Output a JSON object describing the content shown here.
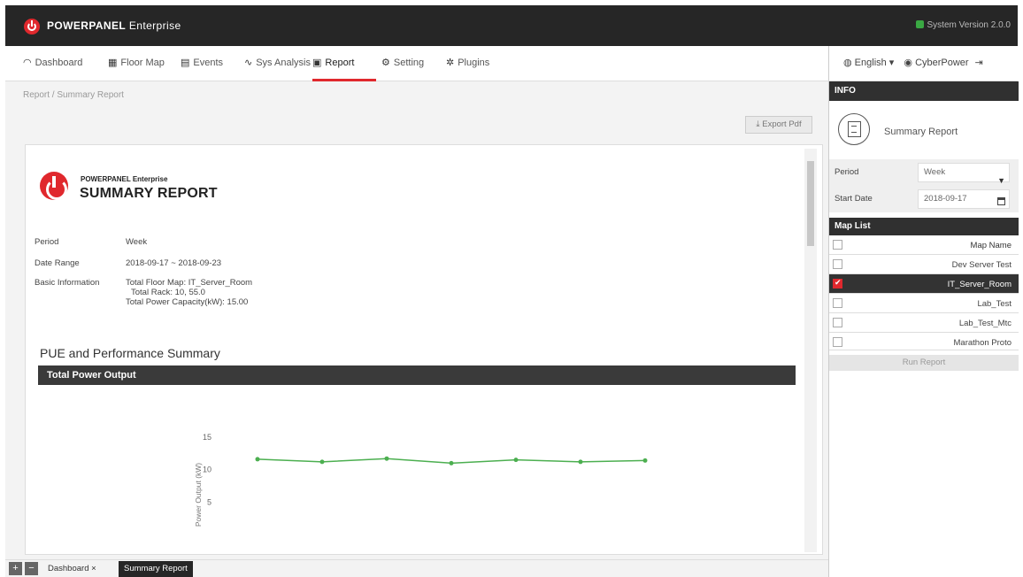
{
  "header": {
    "brand_strong": "POWERPANEL",
    "brand_light": " Enterprise",
    "system_version": "System Version 2.0.0"
  },
  "nav": {
    "items": [
      {
        "label": "Dashboard",
        "icon": "gauge-icon"
      },
      {
        "label": "Floor Map",
        "icon": "map-icon"
      },
      {
        "label": "Events",
        "icon": "events-icon"
      },
      {
        "label": "Sys Analysis",
        "icon": "analysis-icon"
      },
      {
        "label": "Report",
        "icon": "report-icon"
      },
      {
        "label": "Setting",
        "icon": "gear-icon"
      },
      {
        "label": "Plugins",
        "icon": "plugin-icon"
      }
    ],
    "active": "Report",
    "language": "English ▾",
    "user": "CyberPower"
  },
  "breadcrumb": "Report / Summary Report",
  "export_button": "Export Pdf",
  "report": {
    "brand_sub": "POWERPANEL Enterprise",
    "title": "SUMMARY REPORT",
    "fields": [
      {
        "label": "Period",
        "value": "Week"
      },
      {
        "label": "Date Range",
        "value": "2018-09-17 ~ 2018-09-23"
      },
      {
        "label": "Basic Information",
        "value": "Total Floor Map: IT_Server_Room"
      }
    ],
    "basic_info_extra": [
      "Total Rack: 10, 55.0",
      "Total Power Capacity(kW): 15.00"
    ],
    "section_title": "PUE and Performance Summary",
    "section_bar": "Total Power Output"
  },
  "chart_data": {
    "type": "line",
    "ylabel": "Power Output (kW)",
    "yticks": [
      "15",
      "10",
      "5"
    ],
    "ylim": [
      0,
      15
    ],
    "series": [
      {
        "values": [
          11.6,
          11.2,
          11.7,
          11.0,
          11.5,
          11.2,
          11.4
        ]
      }
    ],
    "color": "#4caf50"
  },
  "right_panel": {
    "info_header": "INFO",
    "report_name": "Summary Report",
    "period_label": "Period",
    "period_value": "Week",
    "start_date_label": "Start Date",
    "start_date_value": "2018-09-17",
    "map_list_header": "Map List",
    "map_name_header": "Map Name",
    "maps": [
      {
        "name": "Dev Server Test",
        "checked": false
      },
      {
        "name": "IT_Server_Room",
        "checked": true
      },
      {
        "name": "Lab_Test",
        "checked": false
      },
      {
        "name": "Lab_Test_Mtc",
        "checked": false
      },
      {
        "name": "Marathon Proto",
        "checked": false
      }
    ],
    "run_report": "Run Report"
  },
  "bottom_tabs": {
    "inactive": "Dashboard ×",
    "active": "Summary Report"
  }
}
